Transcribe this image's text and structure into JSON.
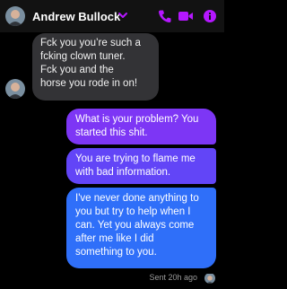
{
  "header": {
    "contact_name": "Andrew Bullock",
    "icons": [
      "avatar",
      "chevron-down-icon",
      "phone-icon",
      "video-icon",
      "info-icon"
    ],
    "accent": "#b517ff"
  },
  "messages": [
    {
      "direction": "incoming",
      "text": "Fck you you’re such a\nfcking clown tuner.\nFck you and the\nhorse you rode in on!"
    },
    {
      "direction": "outgoing",
      "text": "What is your problem?  You\nstarted this shit."
    },
    {
      "direction": "outgoing",
      "text": "You are trying to flame me\nwith bad information."
    },
    {
      "direction": "outgoing",
      "text": "I've never done anything to\nyou but try to help when I\ncan.  Yet you always come\nafter me like I did\nsomething to you."
    }
  ],
  "status_text": "Sent 20h ago",
  "colors": {
    "incoming_bubble": "#333336",
    "outgoing_1": "#7d36f5",
    "outgoing_2": "#6245f7",
    "outgoing_3": "#2f6ff9"
  }
}
